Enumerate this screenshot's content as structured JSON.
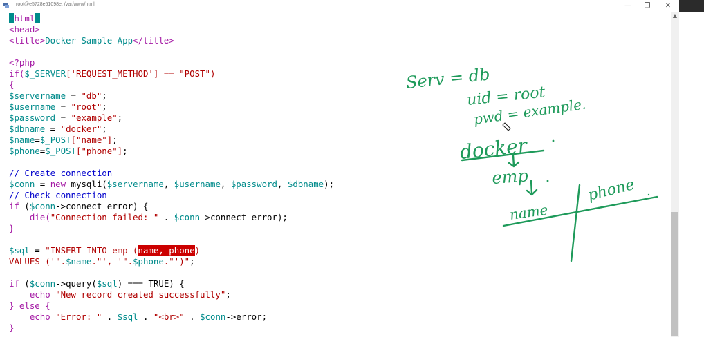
{
  "window": {
    "title": "root@e5728e51098e: /var/www/html",
    "minimize": "—",
    "maximize": "❐",
    "close": "✕"
  },
  "code": {
    "l1": "html",
    "l2": "<head>",
    "l3_open": "<title>",
    "l3_text": "Docker Sample App",
    "l3_close": "</title>",
    "l5": "<?php",
    "l6_a": "if(",
    "l6_b": "$_SERVER",
    "l6_c": "['REQUEST_METHOD'] == \"POST\")",
    "l7": "{",
    "l8_a": "$servername",
    "l8_b": " = ",
    "l8_c": "\"db\"",
    "l8_d": ";",
    "l9_a": "$username",
    "l9_b": " = ",
    "l9_c": "\"root\"",
    "l9_d": ";",
    "l10_a": "$password",
    "l10_b": " = ",
    "l10_c": "\"example\"",
    "l10_d": ";",
    "l11_a": "$dbname",
    "l11_b": " = ",
    "l11_c": "\"docker\"",
    "l11_d": ";",
    "l12_a": "$name",
    "l12_b": "=",
    "l12_c": "$_POST",
    "l12_d": "[\"name\"]",
    "l12_e": ";",
    "l13_a": "$phone",
    "l13_b": "=",
    "l13_c": "$_POST",
    "l13_d": "[\"phone\"]",
    "l13_e": ";",
    "l15": "// Create connection",
    "l16_a": "$conn",
    "l16_b": " = ",
    "l16_c": "new",
    "l16_d": " mysqli(",
    "l16_e": "$servername",
    "l16_f": ", ",
    "l16_g": "$username",
    "l16_h": ", ",
    "l16_i": "$password",
    "l16_j": ", ",
    "l16_k": "$dbname",
    "l16_l": ");",
    "l17": "// Check connection",
    "l18_a": "if",
    "l18_b": " (",
    "l18_c": "$conn",
    "l18_d": "->connect_error) {",
    "l19_a": "    die(",
    "l19_b": "\"Connection failed: \"",
    "l19_c": " . ",
    "l19_d": "$conn",
    "l19_e": "->connect_error);",
    "l20": "}",
    "l22_a": "$sql",
    "l22_b": " = ",
    "l22_c": "\"INSERT INTO emp (",
    "l22_d": "name, phone",
    "l22_e": ")",
    "l23_a": "VALUES ('\".",
    "l23_b": "$name",
    "l23_c": ".\"', '\".",
    "l23_d": "$phone",
    "l23_e": ".\"')\"",
    "l23_f": ";",
    "l25_a": "if",
    "l25_b": " (",
    "l25_c": "$conn",
    "l25_d": "->query(",
    "l25_e": "$sql",
    "l25_f": ") === TRUE) {",
    "l26_a": "    echo ",
    "l26_b": "\"New record created successfully\"",
    "l26_c": ";",
    "l27_a": "} ",
    "l27_b": "else",
    "l27_c": " {",
    "l28_a": "    echo ",
    "l28_b": "\"Error: \"",
    "l28_c": " . ",
    "l28_d": "$sql",
    "l28_e": " . ",
    "l28_f": "\"<br>\"",
    "l28_g": " . ",
    "l28_h": "$conn",
    "l28_i": "->error;",
    "l29": "}"
  },
  "annotations": {
    "server": "Serv = db",
    "uid": "uid = root",
    "pwd": "pwd = example.",
    "db": "docker",
    "table": "emp",
    "col1": "name",
    "col2": "phone"
  },
  "colors": {
    "ink": "#1e9a5a",
    "tag": "#a51ba5",
    "variable": "#008b8b",
    "string": "#b00000",
    "comment": "#0000cc",
    "highlight": "#cc0000"
  }
}
